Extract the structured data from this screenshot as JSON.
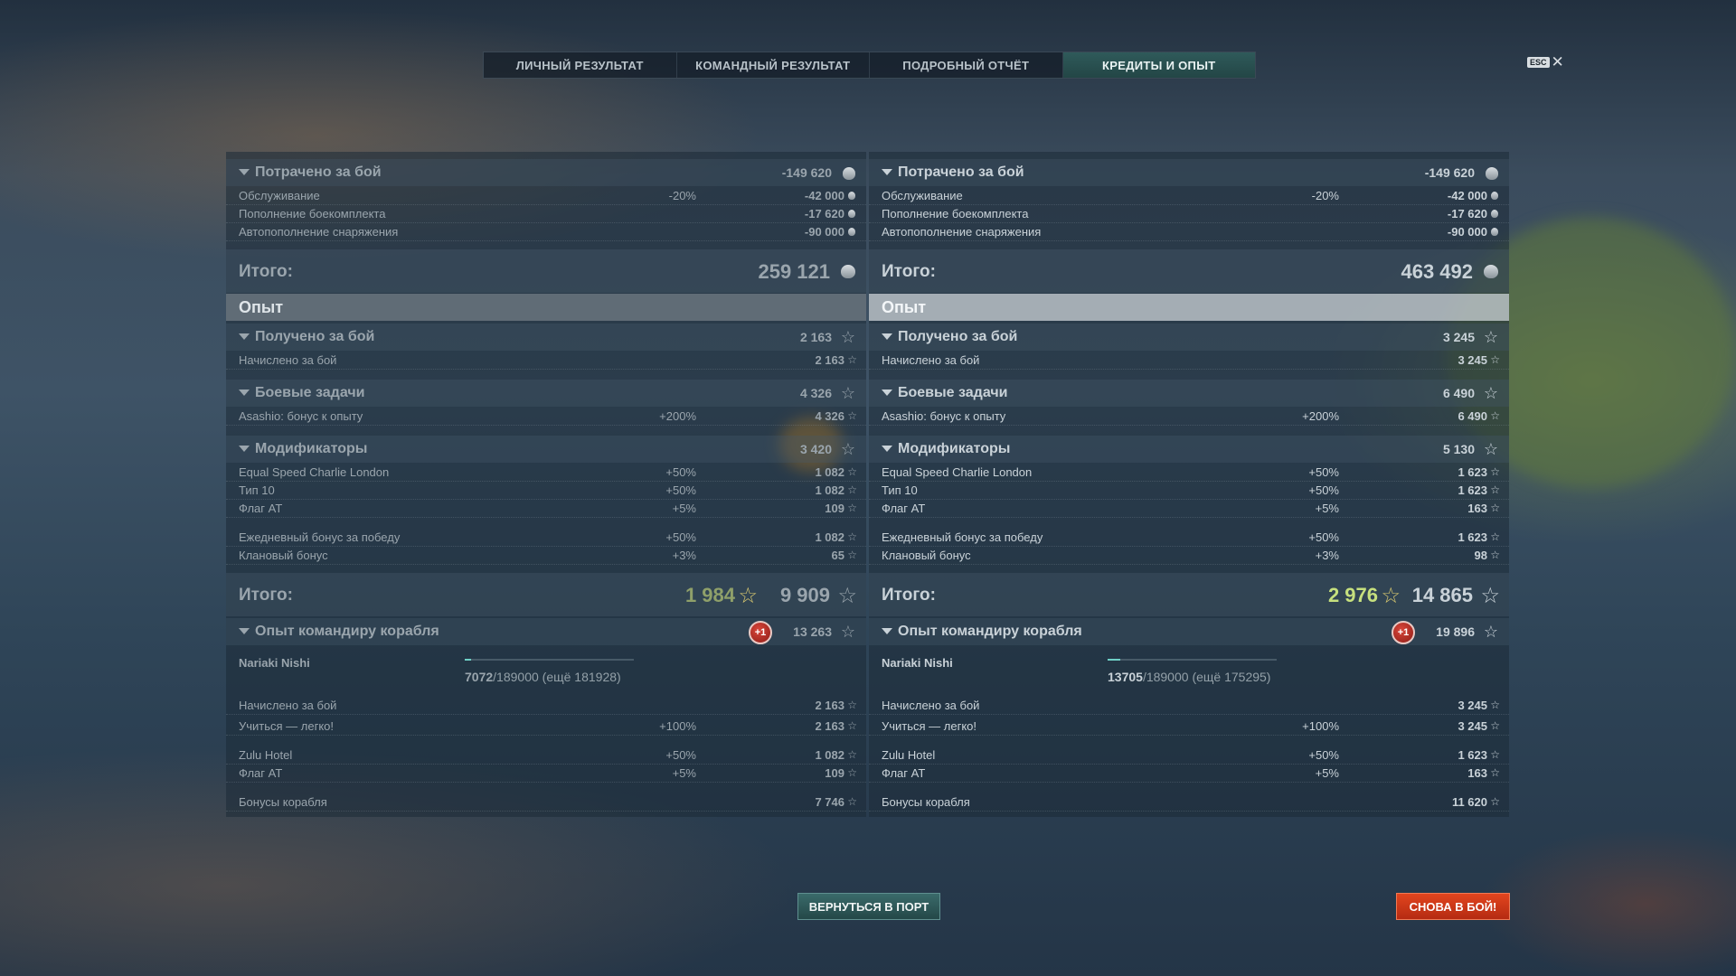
{
  "tabs": [
    {
      "label": "ЛИЧНЫЙ РЕЗУЛЬТАТ",
      "active": false
    },
    {
      "label": "КОМАНДНЫЙ РЕЗУЛЬТАТ",
      "active": false
    },
    {
      "label": "ПОДРОБНЫЙ ОТЧЁТ",
      "active": false
    },
    {
      "label": "КРЕДИТЫ И ОПЫТ",
      "active": true
    }
  ],
  "close": {
    "key": "ESC",
    "icon": "close-icon"
  },
  "panels": {
    "left": {
      "spent": {
        "label": "Потрачено за бой",
        "value": "-149 620",
        "items": [
          {
            "label": "Обслуживание",
            "pct": "-20%",
            "value": "-42 000"
          },
          {
            "label": "Пополнение боекомплекта",
            "pct": "",
            "value": "-17 620"
          },
          {
            "label": "Автопополнение снаряжения",
            "pct": "",
            "value": "-90 000"
          }
        ]
      },
      "credits_total": {
        "label": "Итого:",
        "value": "259 121"
      },
      "xp_section": "Опыт",
      "earned": {
        "label": "Получено за бой",
        "value": "2 163",
        "items": [
          {
            "label": "Начислено за бой",
            "pct": "",
            "value": "2 163"
          }
        ]
      },
      "tasks": {
        "label": "Боевые задачи",
        "value": "4 326",
        "items": [
          {
            "label": "Asashio: бонус к опыту",
            "pct": "+200%",
            "value": "4 326"
          }
        ]
      },
      "modifiers": {
        "label": "Модификаторы",
        "value": "3 420",
        "items": [
          {
            "label": "Equal Speed Charlie London",
            "pct": "+50%",
            "value": "1 082"
          },
          {
            "label": "Тип 10",
            "pct": "+50%",
            "value": "1 082"
          },
          {
            "label": "Флаг AT",
            "pct": "+5%",
            "value": "109"
          },
          {
            "label": "Ежедневный бонус за победу",
            "pct": "+50%",
            "value": "1 082"
          },
          {
            "label": "Клановый бонус",
            "pct": "+3%",
            "value": "65"
          }
        ]
      },
      "xp_total": {
        "label": "Итого:",
        "free": "1 984",
        "value": "9 909"
      },
      "commander": {
        "label": "Опыт командиру корабля",
        "badge": "+1",
        "value": "13 263",
        "name": "Nariaki Nishi",
        "xp_current": "7072",
        "xp_max": "/189000",
        "xp_left": "(ещё 181928)",
        "progress": 0.037,
        "items": [
          {
            "label": "Начислено за бой",
            "pct": "",
            "value": "2 163"
          },
          {
            "label": "Учиться — легко!",
            "pct": "+100%",
            "value": "2 163"
          },
          {
            "label": "Zulu Hotel",
            "pct": "+50%",
            "value": "1 082"
          },
          {
            "label": "Флаг AT",
            "pct": "+5%",
            "value": "109"
          },
          {
            "label": "Бонусы корабля",
            "pct": "",
            "value": "7 746"
          }
        ]
      }
    },
    "right": {
      "spent": {
        "label": "Потрачено за бой",
        "value": "-149 620",
        "items": [
          {
            "label": "Обслуживание",
            "pct": "-20%",
            "value": "-42 000"
          },
          {
            "label": "Пополнение боекомплекта",
            "pct": "",
            "value": "-17 620"
          },
          {
            "label": "Автопополнение снаряжения",
            "pct": "",
            "value": "-90 000"
          }
        ]
      },
      "credits_total": {
        "label": "Итого:",
        "value": "463 492"
      },
      "xp_section": "Опыт",
      "earned": {
        "label": "Получено за бой",
        "value": "3 245",
        "items": [
          {
            "label": "Начислено за бой",
            "pct": "",
            "value": "3 245"
          }
        ]
      },
      "tasks": {
        "label": "Боевые задачи",
        "value": "6 490",
        "items": [
          {
            "label": "Asashio: бонус к опыту",
            "pct": "+200%",
            "value": "6 490"
          }
        ]
      },
      "modifiers": {
        "label": "Модификаторы",
        "value": "5 130",
        "items": [
          {
            "label": "Equal Speed Charlie London",
            "pct": "+50%",
            "value": "1 623"
          },
          {
            "label": "Тип 10",
            "pct": "+50%",
            "value": "1 623"
          },
          {
            "label": "Флаг AT",
            "pct": "+5%",
            "value": "163"
          },
          {
            "label": "Ежедневный бонус за победу",
            "pct": "+50%",
            "value": "1 623"
          },
          {
            "label": "Клановый бонус",
            "pct": "+3%",
            "value": "98"
          }
        ]
      },
      "xp_total": {
        "label": "Итого:",
        "free": "2 976",
        "value": "14 865"
      },
      "commander": {
        "label": "Опыт командиру корабля",
        "badge": "+1",
        "value": "19 896",
        "name": "Nariaki Nishi",
        "xp_current": "13705",
        "xp_max": "/189000",
        "xp_left": "(ещё 175295)",
        "progress": 0.073,
        "items": [
          {
            "label": "Начислено за бой",
            "pct": "",
            "value": "3 245"
          },
          {
            "label": "Учиться — легко!",
            "pct": "+100%",
            "value": "3 245"
          },
          {
            "label": "Zulu Hotel",
            "pct": "+50%",
            "value": "1 623"
          },
          {
            "label": "Флаг AT",
            "pct": "+5%",
            "value": "163"
          },
          {
            "label": "Бонусы корабля",
            "pct": "",
            "value": "11 620"
          }
        ]
      }
    }
  },
  "buttons": {
    "port": "ВЕРНУТЬСЯ В ПОРТ",
    "battle": "СНОВА В БОЙ!"
  },
  "icons": {
    "credits": "credits-icon",
    "xp": "star-icon",
    "free_xp": "free-xp-star-icon"
  },
  "colors": {
    "active_tab": "#2f5a5a",
    "free_xp": "#c6e07e",
    "battle_button": "#d9391a",
    "badge": "#c0342a"
  }
}
